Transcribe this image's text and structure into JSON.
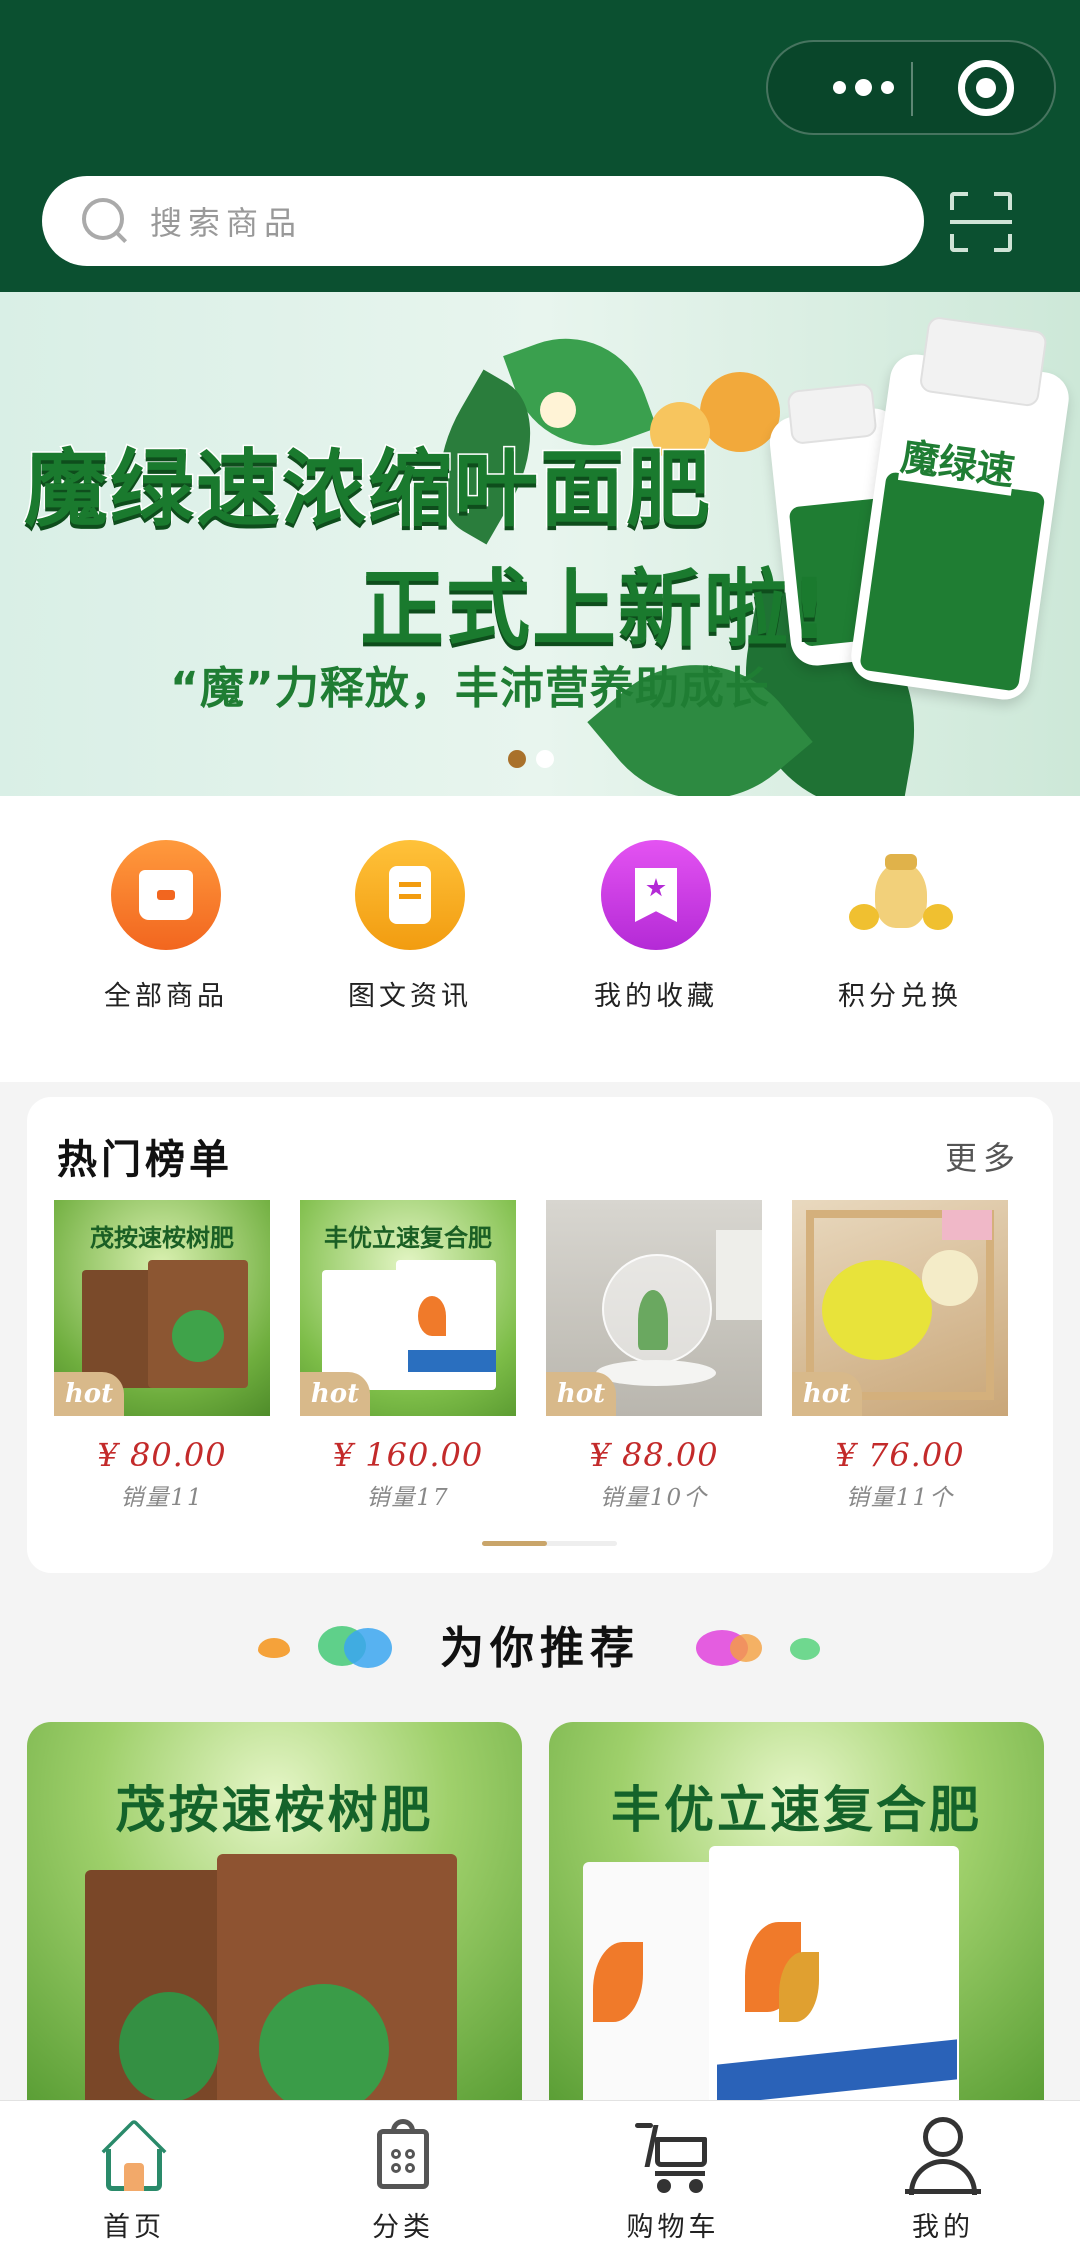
{
  "search": {
    "placeholder": "搜索商品"
  },
  "banner": {
    "line1": "魔绿速浓缩叶面肥",
    "line2": "正式上新啦!",
    "line3": "“魔”力释放，丰沛营养助成长",
    "bottle_name": "魔绿速",
    "slides": 2,
    "active_slide": 1
  },
  "quick_nav": [
    {
      "label": "全部商品",
      "icon": "store-icon",
      "color": "#f47a2a"
    },
    {
      "label": "图文资讯",
      "icon": "document-icon",
      "color": "#f5a514"
    },
    {
      "label": "我的收藏",
      "icon": "bookmark-star-icon",
      "color": "#c63be0"
    },
    {
      "label": "积分兑换",
      "icon": "money-bag-icon",
      "color": "#e8b23a"
    }
  ],
  "hot": {
    "title": "热门榜单",
    "more": "更多",
    "badge": "hot",
    "items": [
      {
        "img_text": "茂按速桉树肥",
        "price": "¥ 80.00",
        "sales": "销量11"
      },
      {
        "img_text": "丰优立速复合肥",
        "price": "¥ 160.00",
        "sales": "销量17"
      },
      {
        "img_text": "",
        "price": "¥ 88.00",
        "sales": "销量10个"
      },
      {
        "img_text": "",
        "price": "¥ 76.00",
        "sales": "销量11个"
      }
    ]
  },
  "recommend": {
    "title": "为你推荐",
    "items": [
      {
        "title": "茂按速桉树肥"
      },
      {
        "title": "丰优立速复合肥"
      }
    ]
  },
  "tabbar": [
    {
      "label": "首页",
      "icon": "home-icon",
      "active": true
    },
    {
      "label": "分类",
      "icon": "category-icon",
      "active": false
    },
    {
      "label": "购物车",
      "icon": "cart-icon",
      "active": false
    },
    {
      "label": "我的",
      "icon": "profile-icon",
      "active": false
    }
  ],
  "colors": {
    "header": "#0b5030",
    "price": "#c32a2a",
    "accent": "#c9a56a",
    "active_tab": "#2a8a6a"
  }
}
